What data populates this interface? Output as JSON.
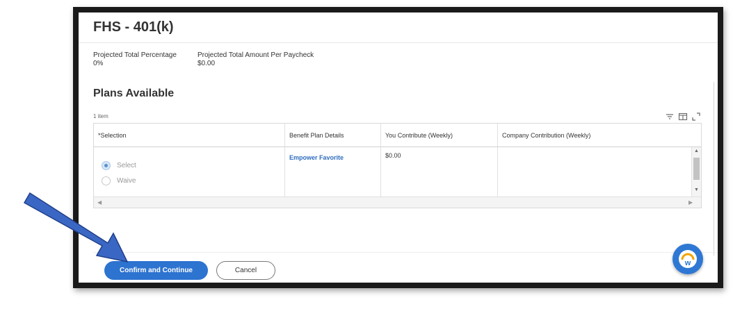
{
  "page": {
    "title": "FHS - 401(k)"
  },
  "summary": {
    "percentage_label": "Projected Total Percentage",
    "percentage_value": "0%",
    "amount_label": "Projected Total Amount Per Paycheck",
    "amount_value": "$0.00"
  },
  "plans": {
    "section_title": "Plans Available",
    "count": "1 item",
    "columns": [
      "*Selection",
      "Benefit Plan Details",
      "You Contribute (Weekly)",
      "Company Contribution (Weekly)"
    ],
    "rows": [
      {
        "selection_options": [
          "Select",
          "Waive"
        ],
        "selected": "Select",
        "plan_details": "Empower Favorite",
        "you_contribute": "$0.00",
        "company_contribution": ""
      }
    ]
  },
  "actions": {
    "confirm_label": "Confirm and Continue",
    "cancel_label": "Cancel"
  },
  "help": {
    "letter": "w"
  },
  "colors": {
    "primary": "#2d73d0",
    "link": "#2f6dbf",
    "annotation_arrow": "#3b67c4"
  },
  "icons": [
    "filter-icon",
    "column-icon",
    "expand-icon",
    "help-icon",
    "annotation-arrow"
  ]
}
